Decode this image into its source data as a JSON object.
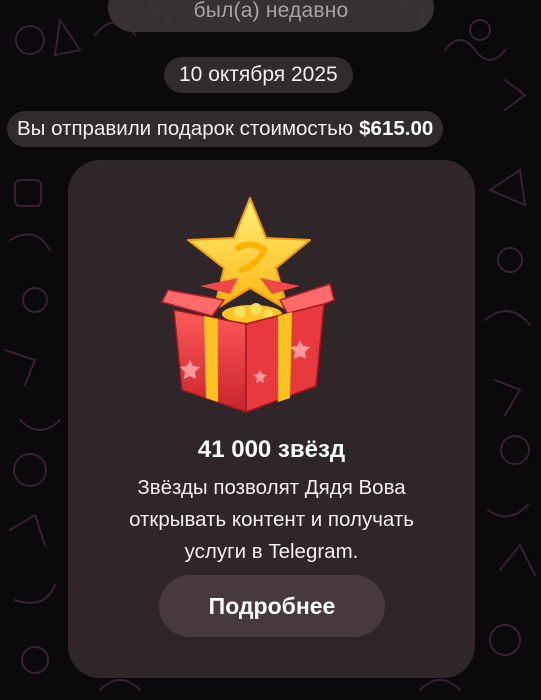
{
  "header": {
    "status": "был(а) недавно"
  },
  "chat": {
    "date_separator": "10 октября 2025",
    "service_message": {
      "text": "Вы отправили подарок стоимостью",
      "amount": "$615.00"
    }
  },
  "gift": {
    "illustration_icon": "gift-box-with-star-icon",
    "title": "41 000 звёзд",
    "description": "Звёзды позволят Дядя Вова открывать контент и получать услуги в Telegram.",
    "button_label": "Подробнее"
  },
  "colors": {
    "background": "#0b090b",
    "bubble": "#342f32",
    "card": "#2e2629",
    "button": "#48393f",
    "star": "#ffd22e",
    "box": "#e8393f"
  }
}
